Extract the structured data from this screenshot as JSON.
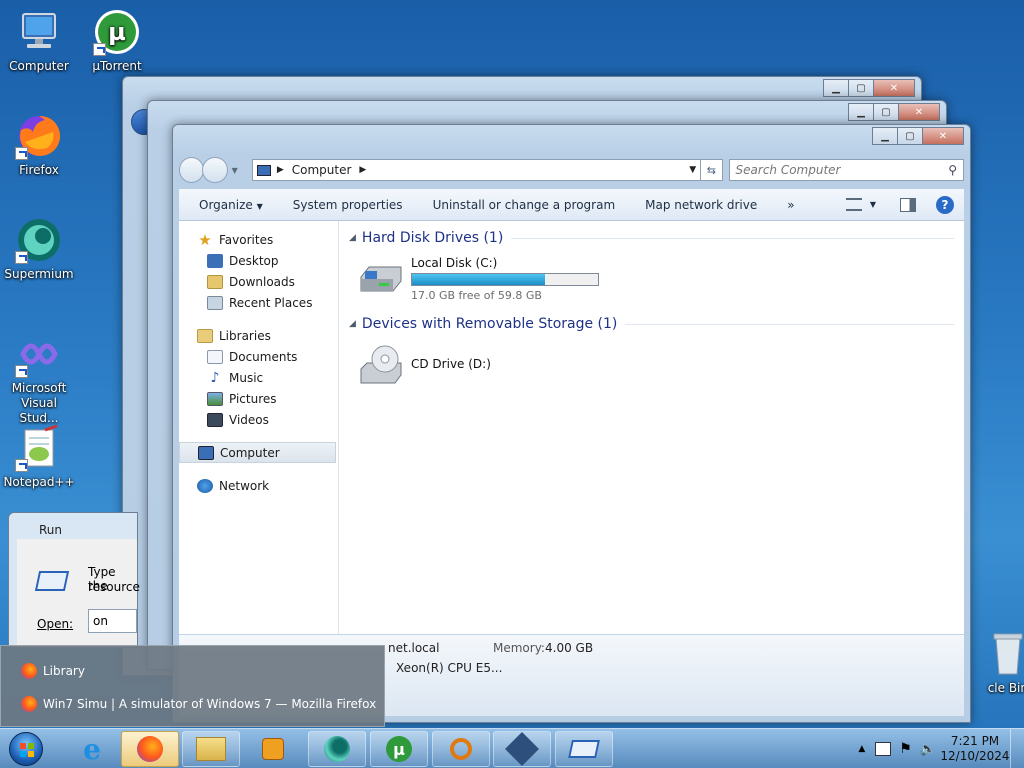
{
  "desktop": {
    "icons": [
      {
        "label": "Computer",
        "icon": "computer-icon"
      },
      {
        "label": "µTorrent",
        "icon": "utorrent-icon"
      },
      {
        "label": "Firefox",
        "icon": "firefox-icon"
      },
      {
        "label": "Supermium",
        "icon": "supermium-icon"
      },
      {
        "label": "Microsoft Visual Stud...",
        "icon": "visual-studio-icon"
      },
      {
        "label": "Notepad++",
        "icon": "notepadpp-icon"
      },
      {
        "label": "cle Bin",
        "icon": "recycle-bin-icon"
      }
    ]
  },
  "explorer": {
    "address": {
      "crumb": "Computer"
    },
    "search": {
      "placeholder": "Search Computer"
    },
    "toolbar": {
      "organize": "Organize",
      "system_properties": "System properties",
      "uninstall": "Uninstall or change a program",
      "map_drive": "Map network drive",
      "more": "»"
    },
    "nav": {
      "favorites": "Favorites",
      "desktop": "Desktop",
      "downloads": "Downloads",
      "recent": "Recent Places",
      "libraries": "Libraries",
      "documents": "Documents",
      "music": "Music",
      "pictures": "Pictures",
      "videos": "Videos",
      "computer": "Computer",
      "network": "Network"
    },
    "groups": {
      "hdd_title": "Hard Disk Drives (1)",
      "removable_title": "Devices with Removable Storage (1)"
    },
    "drive_c": {
      "label": "Local Disk (C:)",
      "free": "17.0 GB free of 59.8 GB",
      "used_fraction": 0.716
    },
    "drive_d": {
      "label": "CD Drive (D:)"
    },
    "details": {
      "domain": "net.local",
      "memory_label": "Memory:",
      "memory_value": "4.00 GB",
      "processor": "Xeon(R) CPU E5..."
    }
  },
  "run": {
    "title": "Run",
    "text1": "Type the",
    "text2": "resource",
    "open_label": "Open:",
    "open_value": "on"
  },
  "jumplist": {
    "items": [
      {
        "label": "Library"
      },
      {
        "label": "Win7 Simu | A simulator of Windows 7 — Mozilla Firefox"
      }
    ]
  },
  "taskbar": {
    "clock_time": "7:21 PM",
    "clock_date": "12/10/2024"
  }
}
